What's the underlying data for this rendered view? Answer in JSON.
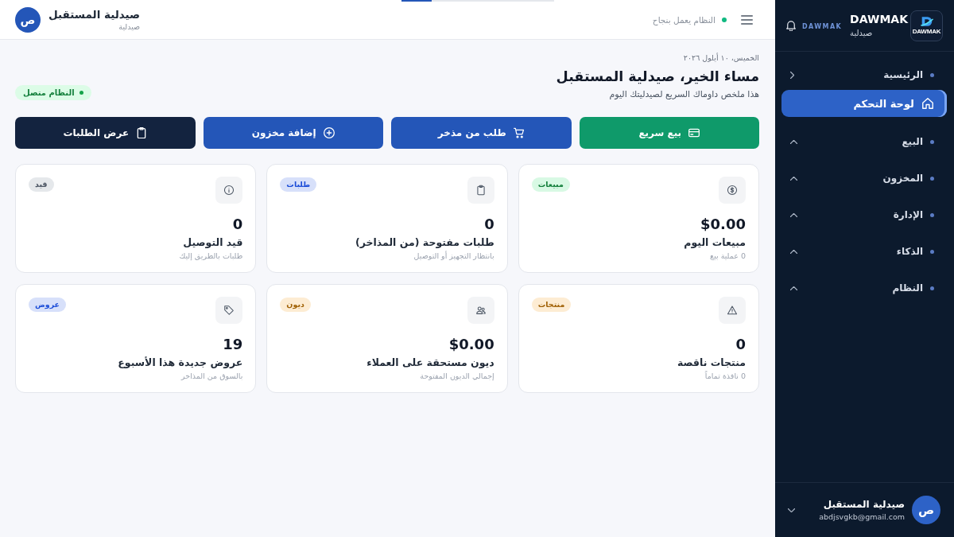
{
  "sidebar": {
    "logo_text": "DAWMAK",
    "brand": "DAWMAK",
    "brand_subtitle": "صيدلية",
    "brand_tag": "DAWMAK",
    "nav": [
      {
        "label": "الرئيسية",
        "expanded": true,
        "children": [
          {
            "label": "لوحة التحكم",
            "selected": true
          }
        ]
      },
      {
        "label": "البيع",
        "expanded": false
      },
      {
        "label": "المخزون",
        "expanded": false
      },
      {
        "label": "الإدارة",
        "expanded": false
      },
      {
        "label": "الذكاء",
        "expanded": false
      },
      {
        "label": "النظام",
        "expanded": false
      }
    ],
    "user": {
      "avatar": "ص",
      "name": "صيدلية المستقبل",
      "email": "abdjsvgkb@gmail.com"
    }
  },
  "top_bar": {
    "loading": {
      "level": 0.2
    },
    "status": "النظام يعمل بنجاح",
    "pharmacy": {
      "avatar": "ص",
      "name": "صيدلية المستقبل",
      "type": "صيدلية"
    }
  },
  "greeting": {
    "date": "الخميس، ١٠ أيلول ٢٠٢٦",
    "title": "مساء الخير، صيدلية المستقبل",
    "subtitle": "هذا ملخص داوماك السريع لصيدليتك اليوم",
    "connection": "النظام متصل"
  },
  "actions": [
    {
      "label": "بيع سريع",
      "kind": "success"
    },
    {
      "label": "طلب من مذخر",
      "kind": "primary"
    },
    {
      "label": "إضافة مخزون",
      "kind": "primary"
    },
    {
      "label": "عرض الطلبات",
      "kind": "dark"
    }
  ],
  "cards": [
    {
      "badge": {
        "label": "مبيعات",
        "color": "#15803d"
      },
      "value": "$0.00",
      "label": "مبيعات اليوم",
      "note": "0 عملية بيع"
    },
    {
      "badge": {
        "label": "طلبات",
        "color": "#1d4ed8"
      },
      "value": "0",
      "label": "طلبات مفتوحة (من المذاخر)",
      "note": "بانتظار التجهيز أو التوصيل"
    },
    {
      "badge": {
        "label": "قيد",
        "color": "#4b5563"
      },
      "value": "0",
      "label": "قيد التوصيل",
      "note": "طلبات بالطريق إليك"
    },
    {
      "badge": {
        "label": "منتجات",
        "color": "#a16207"
      },
      "value": "0",
      "label": "منتجات ناقصة",
      "note": "0 نافذة تماماً"
    },
    {
      "badge": {
        "label": "ديون",
        "color": "#a16207"
      },
      "value": "$0.00",
      "label": "ديون مستحقة على العملاء",
      "note": "إجمالي الديون المفتوحة"
    },
    {
      "badge": {
        "label": "عروض",
        "color": "#1d4ed8"
      },
      "value": "19",
      "label": "عروض جديدة هذا الأسبوع",
      "note": "بالسوق من المذاخر"
    }
  ]
}
